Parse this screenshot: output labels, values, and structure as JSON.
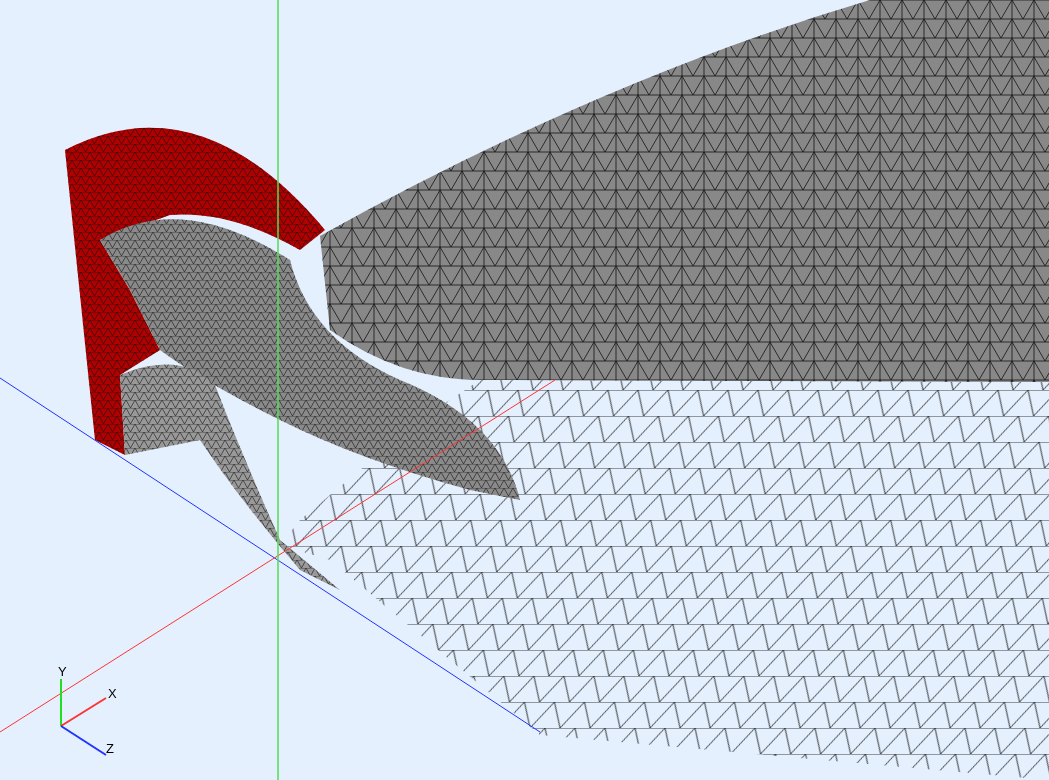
{
  "viewport": {
    "axis_triad": [
      {
        "label": "Y",
        "color": "#22dd22"
      },
      {
        "label": "X",
        "color": "#ff3333"
      },
      {
        "label": "Z",
        "color": "#2233ff"
      }
    ]
  }
}
